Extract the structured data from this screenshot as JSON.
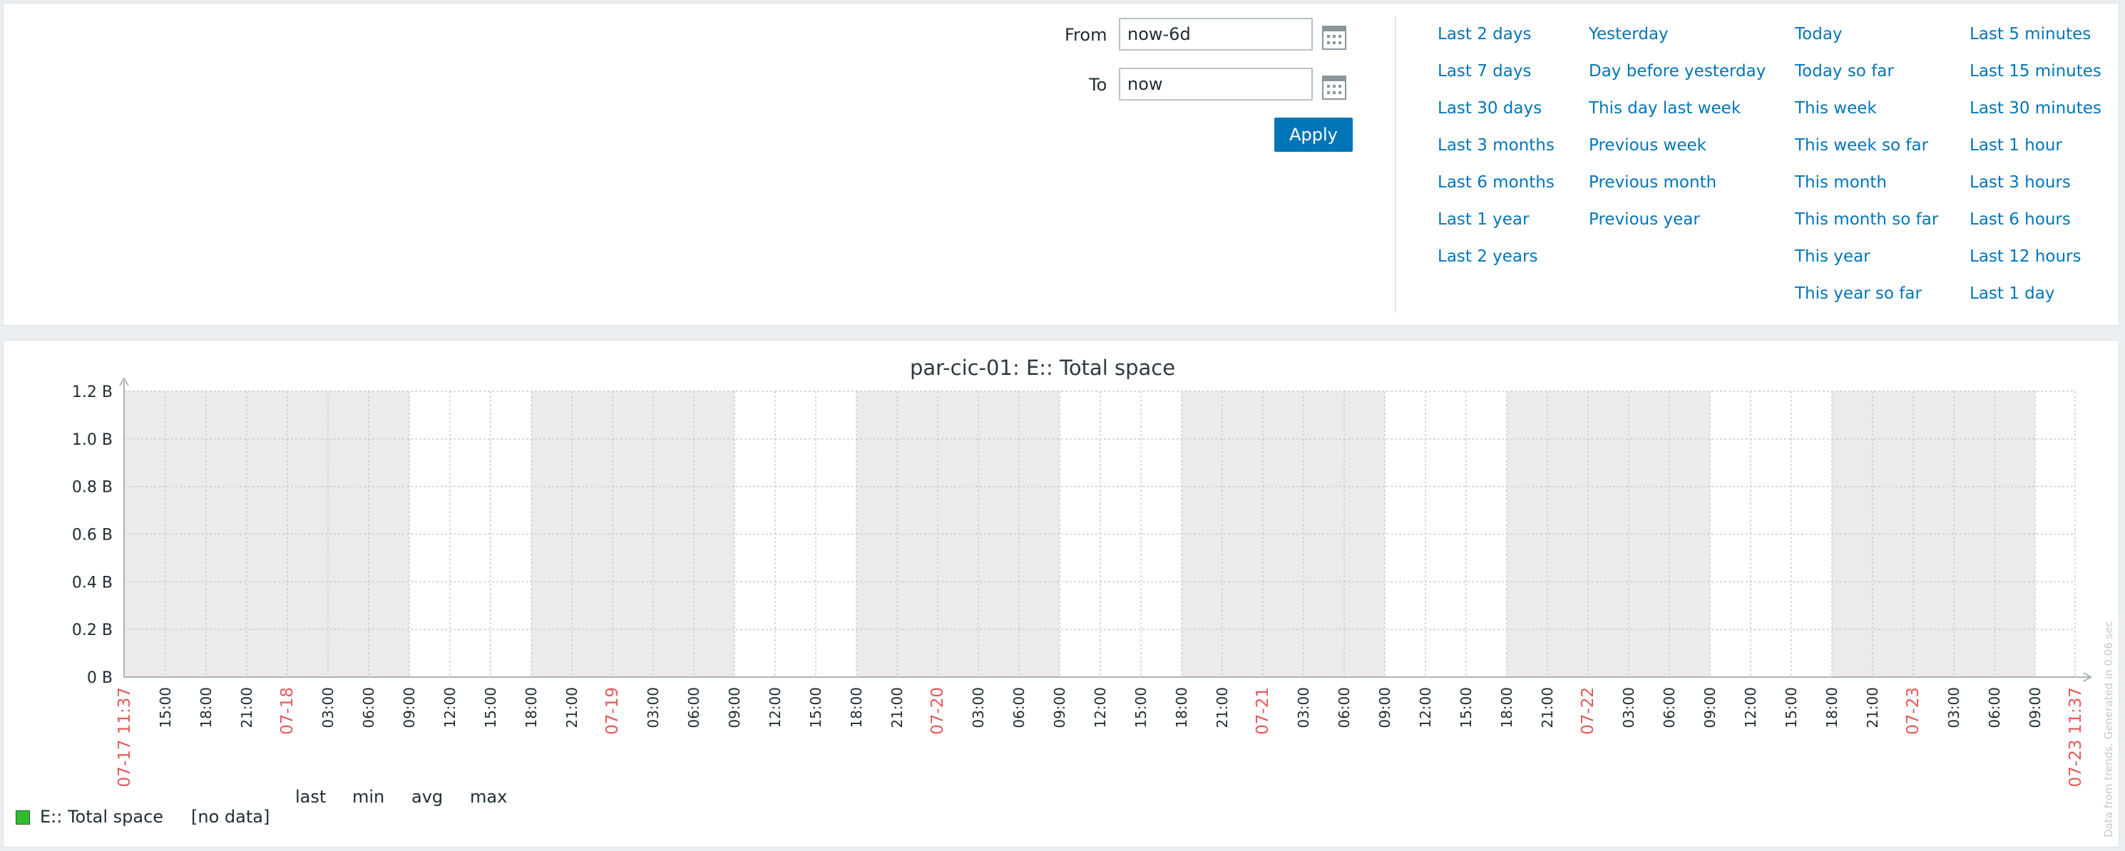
{
  "filter": {
    "from_label": "From",
    "from_value": "now-6d",
    "to_label": "To",
    "to_value": "now",
    "apply_label": "Apply",
    "quick_ranges": [
      [
        "Last 2 days",
        "Last 7 days",
        "Last 30 days",
        "Last 3 months",
        "Last 6 months",
        "Last 1 year",
        "Last 2 years"
      ],
      [
        "Yesterday",
        "Day before yesterday",
        "This day last week",
        "Previous week",
        "Previous month",
        "Previous year"
      ],
      [
        "Today",
        "Today so far",
        "This week",
        "This week so far",
        "This month",
        "This month so far",
        "This year",
        "This year so far"
      ],
      [
        "Last 5 minutes",
        "Last 15 minutes",
        "Last 30 minutes",
        "Last 1 hour",
        "Last 3 hours",
        "Last 6 hours",
        "Last 12 hours",
        "Last 1 day"
      ]
    ]
  },
  "graph": {
    "title": "par-cic-01: E:: Total space",
    "side_note": "Data from trends. Generated in 0.06 sec",
    "legend": {
      "columns": [
        "last",
        "min",
        "avg",
        "max"
      ],
      "item_name": "E:: Total space",
      "item_value": "[no data]",
      "item_color": "#2fbd2f"
    }
  },
  "chart_data": {
    "type": "line",
    "title": "par-cic-01: E:: Total space",
    "y_ticks": [
      "1.2 B",
      "1.0 B",
      "0.8 B",
      "0.6 B",
      "0.4 B",
      "0.2 B",
      "0 B"
    ],
    "ylim": [
      0,
      1.2
    ],
    "x_start_label": "07-17 11:37",
    "x_end_label": "07-23 11:37",
    "x_ticks": [
      "15:00",
      "18:00",
      "21:00",
      "07-18",
      "03:00",
      "06:00",
      "09:00",
      "12:00",
      "15:00",
      "18:00",
      "21:00",
      "07-19",
      "03:00",
      "06:00",
      "09:00",
      "12:00",
      "15:00",
      "18:00",
      "21:00",
      "07-20",
      "03:00",
      "06:00",
      "09:00",
      "12:00",
      "15:00",
      "18:00",
      "21:00",
      "07-21",
      "03:00",
      "06:00",
      "09:00",
      "12:00",
      "15:00",
      "18:00",
      "21:00",
      "07-22",
      "03:00",
      "06:00",
      "09:00",
      "12:00",
      "15:00",
      "18:00",
      "21:00",
      "07-23",
      "03:00",
      "06:00",
      "09:00"
    ],
    "date_tick_color": "#e45959",
    "hour_tick_color": "#1f2c33",
    "background_band_color": "#ebebeb",
    "series": [
      {
        "name": "E:: Total space",
        "values": []
      }
    ],
    "grid": true
  }
}
